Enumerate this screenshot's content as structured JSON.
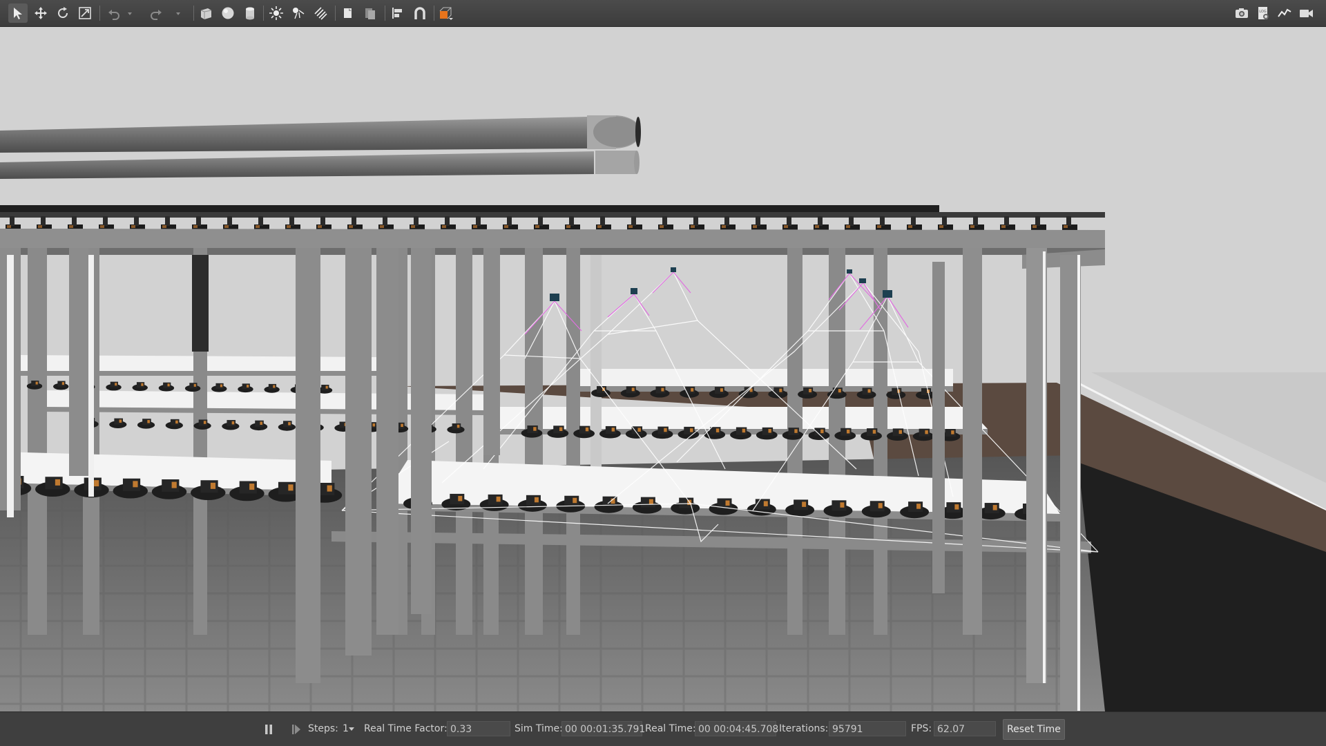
{
  "toolbar": {
    "left_tools": [
      "select-mode-icon",
      "translate-mode-icon",
      "rotate-mode-icon",
      "scale-mode-icon",
      "undo-icon",
      "undo-dropdown-icon",
      "redo-icon",
      "redo-dropdown-icon",
      "box-shape-icon",
      "sphere-shape-icon",
      "cylinder-shape-icon",
      "point-light-icon",
      "spot-light-icon",
      "directional-light-icon",
      "copy-icon",
      "paste-icon",
      "align-icon",
      "snap-icon",
      "view-angle-icon"
    ],
    "right_tools": [
      "screenshot-icon",
      "log-icon",
      "plot-icon",
      "record-video-icon"
    ],
    "accent": "#e8741c"
  },
  "status": {
    "steps_label": "Steps:",
    "steps_value": "1",
    "rtf_label": "Real Time Factor:",
    "rtf_value": "0.33",
    "sim_time_label": "Sim Time:",
    "sim_time_value": "00 00:01:35.791",
    "real_time_label": "Real Time:",
    "real_time_value": "00 00:04:45.708",
    "iterations_label": "Iterations:",
    "iterations_value": "95791",
    "fps_label": "FPS:",
    "fps_value": "62.07",
    "reset_label": "Reset Time"
  },
  "scene": {
    "sky_color": "#d2d2d2",
    "floor_color": "#6e6e6e",
    "brown_floor_color": "#5b4a40",
    "beam_color": "#8b8b8b",
    "shelf_color": "#f2f2f2",
    "frustum_color": "#e070e0"
  }
}
